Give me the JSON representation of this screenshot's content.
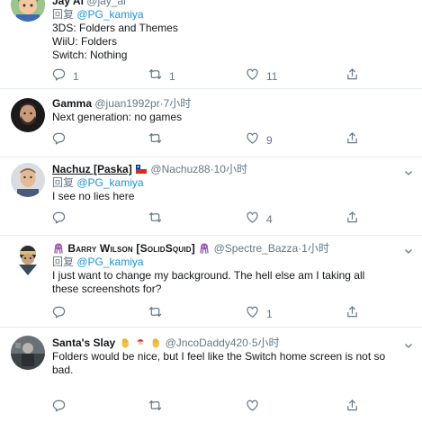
{
  "tweets": [
    {
      "name": "Jay Ai",
      "handle": "@jay_ai",
      "time": "",
      "reply_prefix": "回复",
      "reply_handle": "@PG_kamiya",
      "lines": [
        "3DS: Folders and Themes",
        "WiiU: Folders",
        "Switch: Nothing"
      ],
      "replies": "1",
      "retweets": "1",
      "likes": "11"
    },
    {
      "name": "Gamma",
      "handle": "@juan1992pr",
      "time": "7小时",
      "lines": [
        "Next generation: no games"
      ],
      "replies": "",
      "retweets": "",
      "likes": "9"
    },
    {
      "name": "Nachuz [Paska]",
      "handle": "@Nachuz88",
      "time": "10小时",
      "reply_prefix": "回复",
      "reply_handle": "@PG_kamiya",
      "lines": [
        "I see no lies here"
      ],
      "replies": "",
      "retweets": "",
      "likes": "4"
    },
    {
      "name": "Barry Wilson [SolidSquid]",
      "handle": "@Spectre_Bazza",
      "time": "1小时",
      "reply_prefix": "回复",
      "reply_handle": "@PG_kamiya",
      "lines": [
        "I just want to change my background. The hell else am I taking all",
        "these screenshots for?"
      ],
      "replies": "",
      "retweets": "",
      "likes": "1"
    },
    {
      "name": "Santa's Slay",
      "handle": "@JncoDaddy420",
      "time": "5小时",
      "lines": [
        "Folders would be nice, but I feel like the Switch home screen is not so",
        "bad."
      ],
      "replies": "",
      "retweets": "",
      "likes": ""
    }
  ],
  "separator": "·",
  "colors": {
    "link": "#1b95e0",
    "meta": "#657786",
    "text": "#14171a",
    "border": "#e6ecf0"
  },
  "icons": [
    "reply-icon",
    "retweet-icon",
    "like-icon",
    "share-icon",
    "chevron-down-icon",
    "chile-flag-icon",
    "squid-icon",
    "santa-icon",
    "raised-hand-icon"
  ]
}
